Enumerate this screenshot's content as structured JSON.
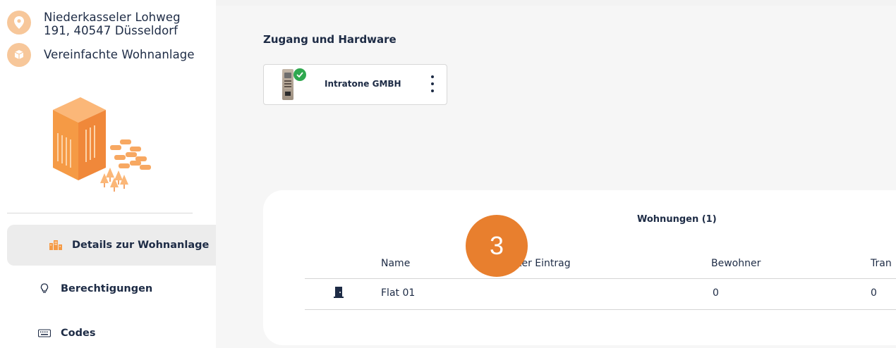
{
  "sidebar": {
    "address_line1": "Niederkasseler Lohweg",
    "address_line2": "191, 40547 Düsseldorf",
    "residence_type": "Vereinfachte Wohnanlage",
    "nav": [
      {
        "label": "Details zur Wohnanlage",
        "icon": "building-icon",
        "active": true
      },
      {
        "label": "Berechtigungen",
        "icon": "lightbulb-icon",
        "active": false
      },
      {
        "label": "Codes",
        "icon": "keyboard-icon",
        "active": false
      }
    ]
  },
  "main": {
    "section_title": "Zugang und Hardware",
    "hardware": {
      "name": "Intratone GMBH",
      "status": "connected"
    },
    "flats": {
      "title": "Wohnungen (1)",
      "columns": [
        "Name",
        "ter Eintrag",
        "Bewohner",
        "Tran"
      ],
      "rows": [
        {
          "icon": "door-icon",
          "name": "Flat 01",
          "entry": "",
          "residents": "0",
          "trans": "0"
        }
      ]
    }
  },
  "overlay": {
    "step_number": "3",
    "color": "#e87f2e"
  },
  "colors": {
    "accent": "#f5a15c",
    "text": "#1d2b45",
    "success": "#2fa84f"
  }
}
